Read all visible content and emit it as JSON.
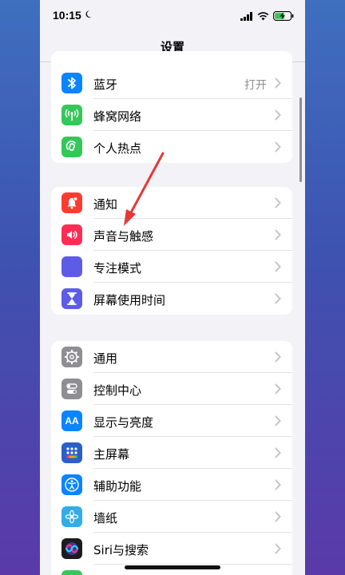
{
  "status_bar": {
    "time": "10:15"
  },
  "nav": {
    "title": "设置"
  },
  "groups": [
    {
      "items": [
        {
          "label": "蓝牙",
          "value": "打开",
          "icon": "bluetooth-icon",
          "color": "#0a84ff"
        },
        {
          "label": "蜂窝网络",
          "icon": "cellular-icon",
          "color": "#34c759"
        },
        {
          "label": "个人热点",
          "icon": "hotspot-icon",
          "color": "#34c759"
        }
      ]
    },
    {
      "items": [
        {
          "label": "通知",
          "icon": "notifications-icon",
          "color": "#ff3b30"
        },
        {
          "label": "声音与触感",
          "icon": "sounds-icon",
          "color": "#ff2d55"
        },
        {
          "label": "专注模式",
          "icon": "moon-icon",
          "color": "#5e5ce6"
        },
        {
          "label": "屏幕使用时间",
          "icon": "hourglass-icon",
          "color": "#5e5ce6"
        }
      ]
    },
    {
      "items": [
        {
          "label": "通用",
          "icon": "gear-icon",
          "color": "#8e8e93"
        },
        {
          "label": "控制中心",
          "icon": "switches-icon",
          "color": "#8e8e93"
        },
        {
          "label": "显示与亮度",
          "icon": "text-size-icon",
          "color": "#0a84ff"
        },
        {
          "label": "主屏幕",
          "icon": "home-grid-icon",
          "color": "#2c5ec9"
        },
        {
          "label": "辅助功能",
          "icon": "accessibility-icon",
          "color": "#0a84ff"
        },
        {
          "label": "墙纸",
          "icon": "wallpaper-icon",
          "color": "#32ade6"
        },
        {
          "label": "Siri与搜索",
          "icon": "siri-icon",
          "color": "#1c1c1e"
        }
      ]
    }
  ],
  "icon_text": {
    "text_size": "AA"
  },
  "annotation": {
    "color": "#e53935"
  }
}
